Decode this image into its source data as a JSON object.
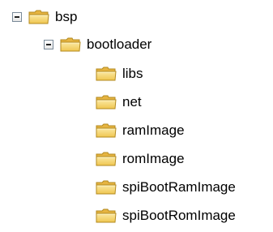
{
  "tree": {
    "nodes": [
      {
        "label": "bsp",
        "icon": "folder-icon",
        "state": "expanded"
      },
      {
        "label": "bootloader",
        "icon": "folder-icon",
        "state": "expanded"
      },
      {
        "label": "libs",
        "icon": "folder-icon"
      },
      {
        "label": "net",
        "icon": "folder-icon"
      },
      {
        "label": "ramImage",
        "icon": "folder-icon"
      },
      {
        "label": "romImage",
        "icon": "folder-icon"
      },
      {
        "label": "spiBootRamImage",
        "icon": "folder-icon"
      },
      {
        "label": "spiBootRomImage",
        "icon": "folder-icon"
      }
    ]
  },
  "colors": {
    "folder_fill": "#f5d97a",
    "folder_shade": "#e8b93c",
    "folder_outline": "#b38a1f",
    "expander_border": "#7a8a99"
  }
}
